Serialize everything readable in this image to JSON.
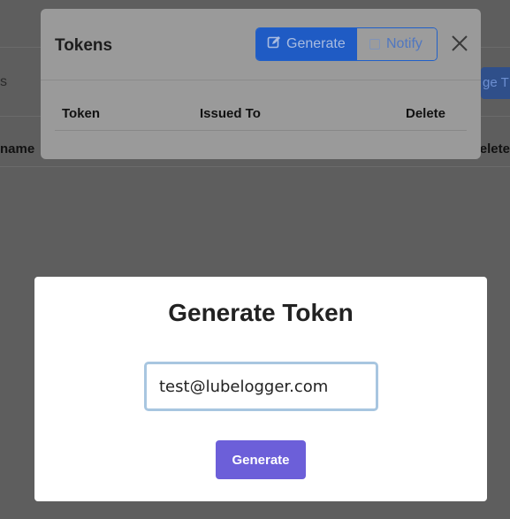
{
  "background": {
    "tab_fragment": "s",
    "column_left_fragment": "name",
    "column_right_fragment": "elete",
    "button_fragment": "ge T"
  },
  "tokens_modal": {
    "title": "Tokens",
    "generate_label": "Generate",
    "notify_label": "Notify",
    "table_headers": [
      "Token",
      "Issued To",
      "Delete"
    ]
  },
  "generate_dialog": {
    "title": "Generate Token",
    "email_value": "test@lubelogger.com",
    "button_label": "Generate"
  }
}
